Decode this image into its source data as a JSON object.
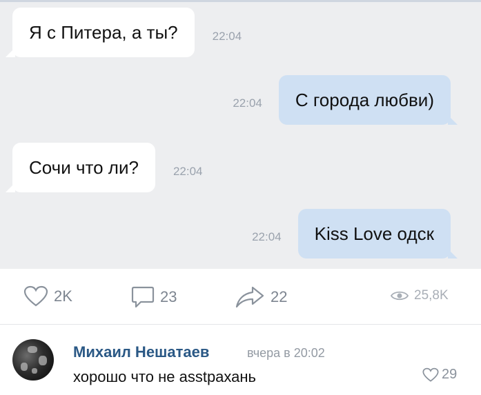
{
  "messages": [
    {
      "side": "in",
      "text": "Я с Питера, а ты?",
      "time": "22:04"
    },
    {
      "side": "out",
      "text": "С города любви)",
      "time": "22:04"
    },
    {
      "side": "in",
      "text": "Сочи что ли?",
      "time": "22:04"
    },
    {
      "side": "out",
      "text": "Kiss Love одск",
      "time": "22:04"
    }
  ],
  "actions": {
    "likes": "2K",
    "comments": "23",
    "shares": "22",
    "views": "25,8K"
  },
  "comment": {
    "author": "Михаил Нешатаев",
    "meta": "вчера в 20:02",
    "text": "хорошо что не asstрахань",
    "likes": "29"
  },
  "icons": {
    "like": "heart-icon",
    "comment": "comment-icon",
    "share": "share-icon",
    "views": "eye-icon"
  },
  "colors": {
    "chat_background": "#edeef0",
    "incoming_bubble": "#ffffff",
    "outgoing_bubble": "#cfe0f3",
    "author_name": "#2a5885"
  }
}
